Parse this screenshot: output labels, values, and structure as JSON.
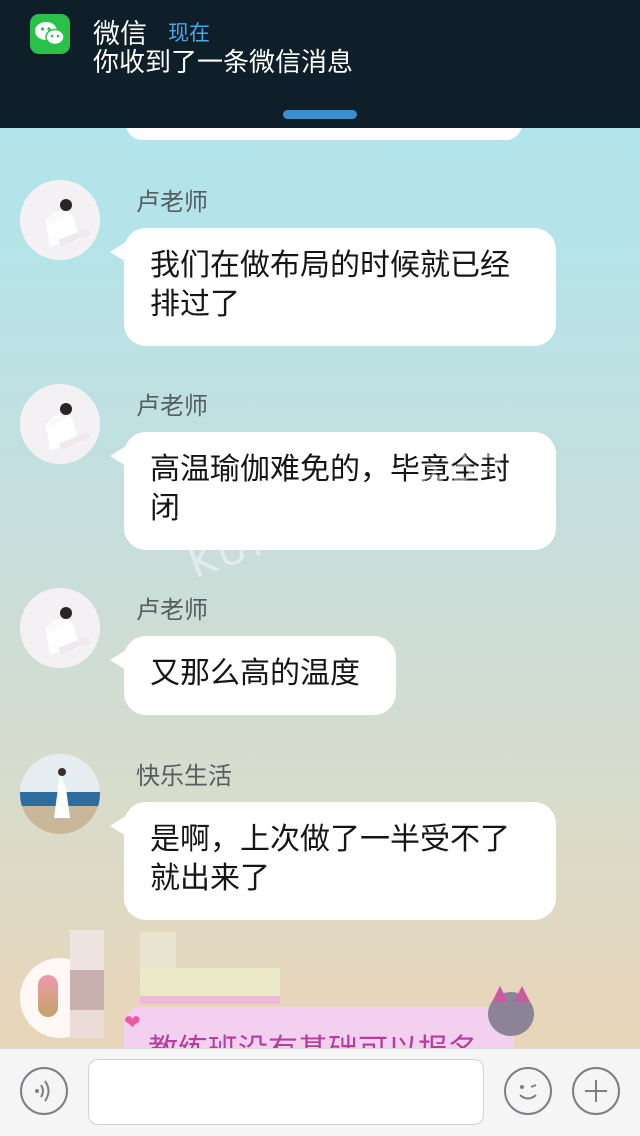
{
  "notification": {
    "app_name": "微信",
    "time": "现在",
    "message": "你收到了一条微信消息",
    "app_icon": "wechat-icon"
  },
  "watermark": {
    "line1": "昆山论坛",
    "line2": "KUNSHAN BBS"
  },
  "messages": [
    {
      "sender": "卢老师",
      "lines": [
        "我们在做布局的时候就已经",
        "排过了"
      ]
    },
    {
      "sender": "卢老师",
      "lines": [
        "高温瑜伽难免的，毕竟全封",
        "闭"
      ]
    },
    {
      "sender": "卢老师",
      "lines": [
        "又那么高的温度"
      ]
    },
    {
      "sender": "快乐生活",
      "lines": [
        "是啊，上次做了一半受不了",
        "就出来了"
      ]
    }
  ],
  "partial_message": {
    "text": "教练班没有基础可以报名"
  },
  "input_bar": {
    "voice_icon": "voice-icon",
    "emoji_icon": "emoji-icon",
    "plus_icon": "plus-icon",
    "input_value": ""
  }
}
